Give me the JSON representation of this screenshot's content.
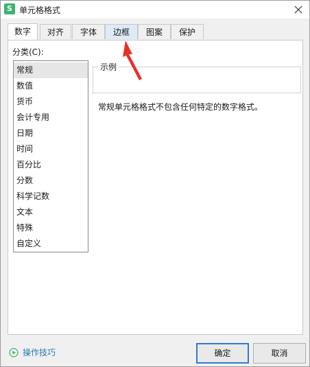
{
  "window": {
    "title": "单元格格式",
    "app_icon_glyph": "S",
    "app_icon_color": "#3cb371"
  },
  "tabs": [
    {
      "label": "数字",
      "active": true
    },
    {
      "label": "对齐",
      "active": false
    },
    {
      "label": "字体",
      "active": false
    },
    {
      "label": "边框",
      "active": false,
      "highlighted": true
    },
    {
      "label": "图案",
      "active": false
    },
    {
      "label": "保护",
      "active": false
    }
  ],
  "category": {
    "label": "分类(C):",
    "items": [
      "常规",
      "数值",
      "货币",
      "会计专用",
      "日期",
      "时间",
      "百分比",
      "分数",
      "科学记数",
      "文本",
      "特殊",
      "自定义"
    ],
    "selected_index": 0
  },
  "sample": {
    "label": "示例",
    "value": ""
  },
  "description": "常规单元格格式不包含任何特定的数字格式。",
  "footer": {
    "help_label": "操作技巧",
    "ok_label": "确定",
    "cancel_label": "取消"
  },
  "annotation": {
    "arrow_color": "#e8302a"
  }
}
